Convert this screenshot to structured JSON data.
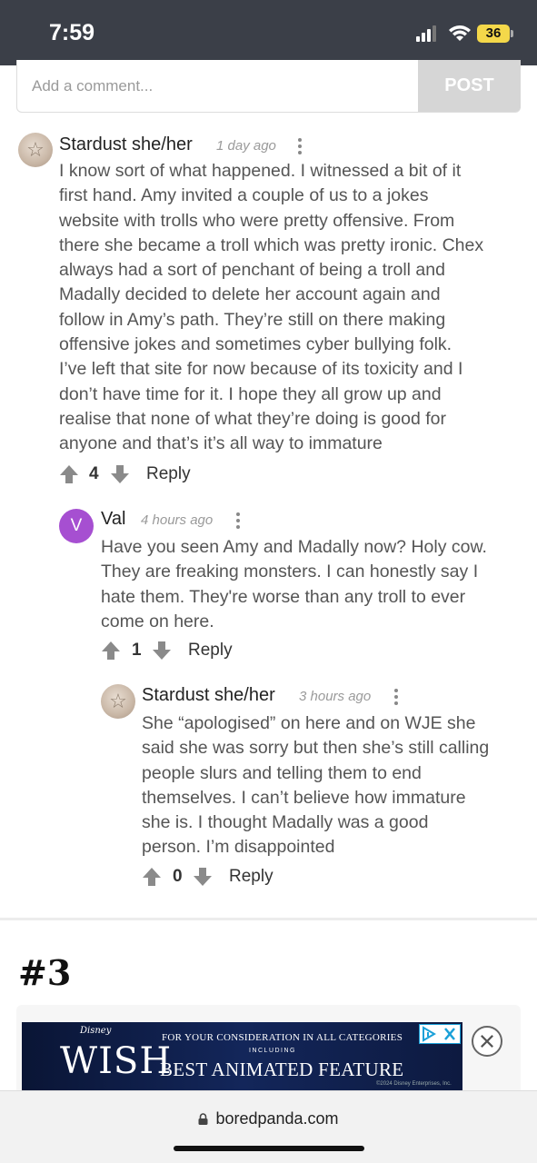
{
  "status": {
    "time": "7:59",
    "battery": "36"
  },
  "comment_form": {
    "placeholder": "Add a comment...",
    "post_label": "POST"
  },
  "comments": [
    {
      "author": "Stardust she/her",
      "time": "1 day ago",
      "lines": [
        "I know sort of what happened. I witnessed a bit of it",
        "first hand. Amy invited a couple of us to a jokes",
        "website with trolls who were pretty offensive. From",
        "there she became a troll which was pretty ironic. Chex",
        "always had a sort of penchant of being a troll and",
        "Madally decided to delete her account again and",
        "follow in Amy’s path. They’re still on there making",
        "offensive jokes and sometimes cyber bullying folk.",
        "I’ve left that site for now because of its toxicity and I",
        "don’t have time for it. I hope they all grow up and",
        "realise that none of what they’re doing is good for",
        "anyone and that’s it’s all way to immature"
      ],
      "score": "4",
      "reply_label": "Reply"
    },
    {
      "author": "Val",
      "avatar_letter": "V",
      "time": "4 hours ago",
      "lines": [
        "Have you seen Amy and Madally now? Holy cow.",
        "They are freaking monsters. I can honestly say I",
        "hate them. They're worse than any troll to ever",
        "come on here."
      ],
      "score": "1",
      "reply_label": "Reply"
    },
    {
      "author": "Stardust she/her",
      "time": "3 hours ago",
      "lines": [
        "She “apologised” on here and on WJE she",
        "said she was sorry but then she’s still calling",
        "people slurs and telling them to end",
        "themselves. I can’t believe how immature",
        "she is. I thought Madally was a good",
        "person. I’m disappointed"
      ],
      "score": "0",
      "reply_label": "Reply"
    }
  ],
  "section_number": "#3",
  "ad": {
    "brand": "Disney",
    "title": "WISH",
    "line1": "FOR YOUR CONSIDERATION IN ALL CATEGORIES",
    "line2": "INCLUDING",
    "line3": "BEST ANIMATED FEATURE",
    "legal": "©2024 Disney Enterprises, Inc."
  },
  "browser": {
    "url": "boredpanda.com"
  },
  "colors": {
    "status_bar": "#3b3f48",
    "val_avatar": "#a64fd1",
    "post_button": "#d6d6d6",
    "battery": "#f4d84a"
  }
}
